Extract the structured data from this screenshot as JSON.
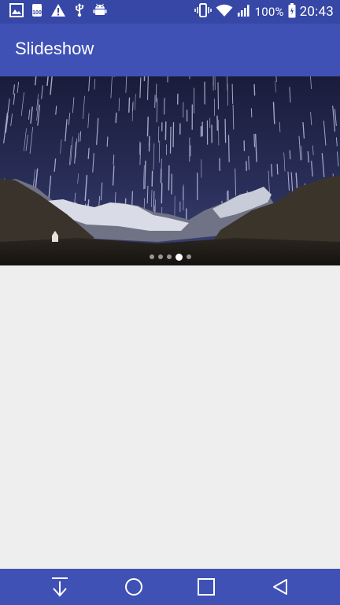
{
  "status_bar": {
    "battery_percent": "100%",
    "time": "20:43",
    "left_icons": [
      "image-notification-icon",
      "storage-100-icon",
      "warning-icon",
      "usb-icon",
      "android-debug-icon"
    ],
    "right_icons": [
      "vibrate-icon",
      "wifi-icon",
      "cellular-signal-icon",
      "battery-icon"
    ]
  },
  "app_bar": {
    "title": "Slideshow",
    "color": "#3f51b5"
  },
  "slideshow": {
    "slide_count": 5,
    "active_index": 3,
    "image_description_icon": "star-trails-mountain-image"
  },
  "navigation_bar": {
    "buttons": [
      "download-arrow-icon",
      "home-circle-icon",
      "recents-square-icon",
      "back-triangle-icon"
    ]
  },
  "colors": {
    "status_bar": "#3647a6",
    "primary": "#3f51b5",
    "background": "#eeeeee"
  }
}
